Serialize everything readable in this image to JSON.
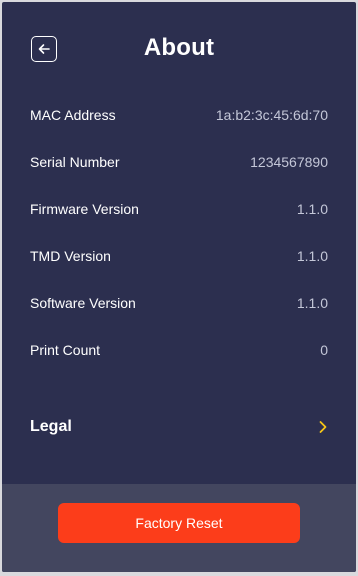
{
  "header": {
    "title": "About",
    "back_icon": "back-arrow-icon"
  },
  "info": {
    "rows": [
      {
        "label": "MAC Address",
        "value": "1a:b2:3c:45:6d:70"
      },
      {
        "label": "Serial Number",
        "value": "1234567890"
      },
      {
        "label": "Firmware Version",
        "value": "1.1.0"
      },
      {
        "label": "TMD Version",
        "value": "1.1.0"
      },
      {
        "label": "Software Version",
        "value": "1.1.0"
      },
      {
        "label": "Print Count",
        "value": "0"
      }
    ]
  },
  "legal": {
    "label": "Legal",
    "icon": "chevron-right-icon"
  },
  "footer": {
    "reset_label": "Factory Reset"
  },
  "colors": {
    "background": "#2c2f4f",
    "footer_background": "#43465f",
    "accent_yellow": "#f5c518",
    "button_orange": "#fc3d1a",
    "value_gray": "#c4c7d8"
  }
}
